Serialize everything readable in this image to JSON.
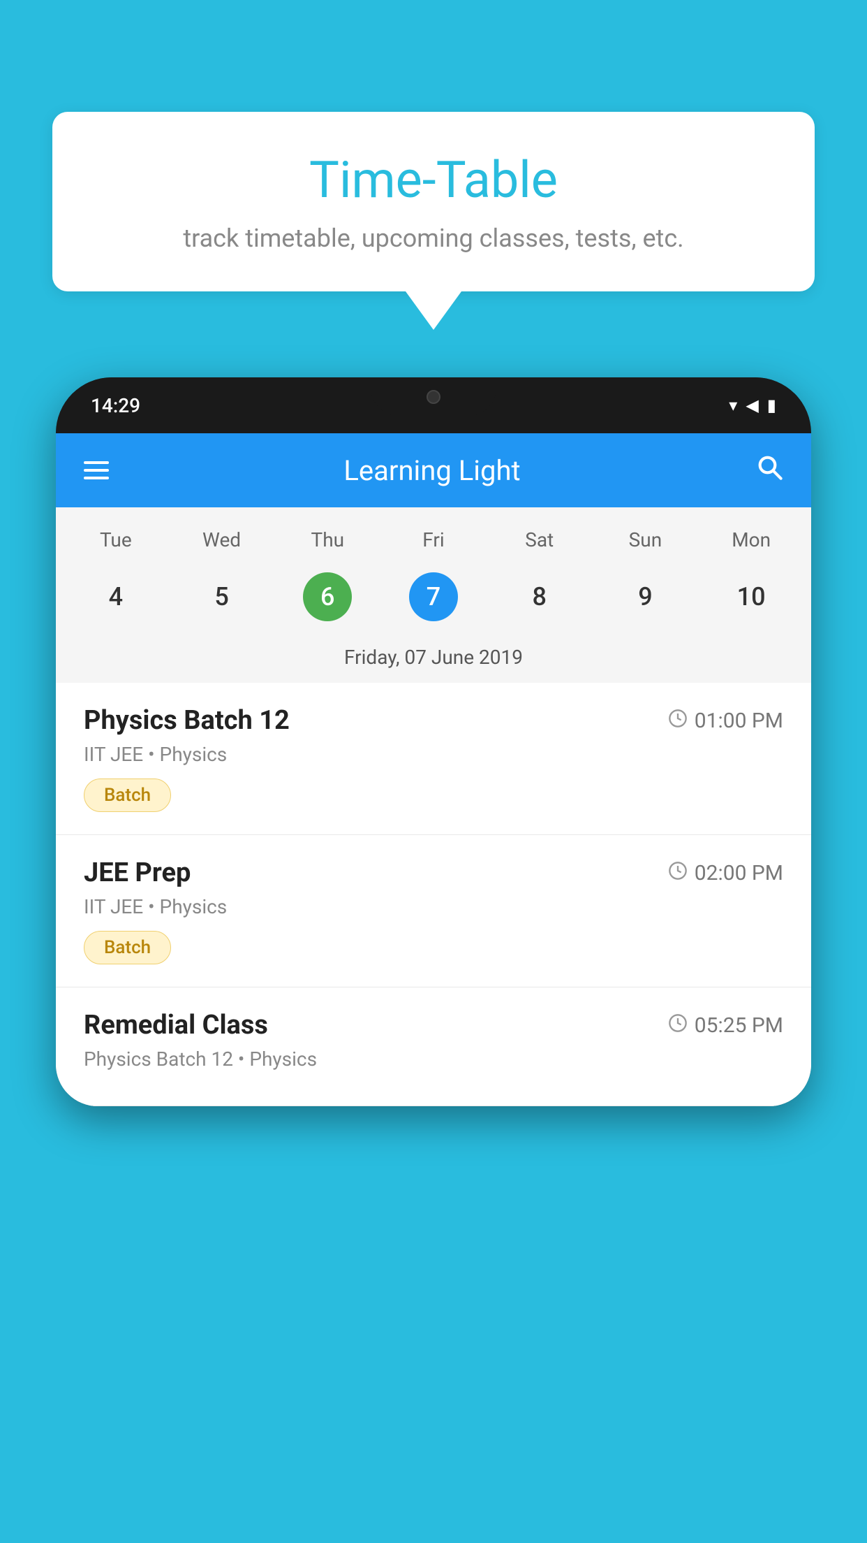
{
  "background_color": "#29BCDE",
  "speech_bubble": {
    "title": "Time-Table",
    "subtitle": "track timetable, upcoming classes, tests, etc."
  },
  "phone": {
    "status_bar": {
      "time": "14:29"
    },
    "app_bar": {
      "title": "Learning Light"
    },
    "calendar": {
      "days": [
        "Tue",
        "Wed",
        "Thu",
        "Fri",
        "Sat",
        "Sun",
        "Mon"
      ],
      "dates": [
        "4",
        "5",
        "6",
        "7",
        "8",
        "9",
        "10"
      ],
      "today_index": 2,
      "selected_index": 3,
      "selected_label": "Friday, 07 June 2019"
    },
    "schedule": [
      {
        "title": "Physics Batch 12",
        "time": "01:00 PM",
        "subtitle": "IIT JEE • Physics",
        "tag": "Batch"
      },
      {
        "title": "JEE Prep",
        "time": "02:00 PM",
        "subtitle": "IIT JEE • Physics",
        "tag": "Batch"
      },
      {
        "title": "Remedial Class",
        "time": "05:25 PM",
        "subtitle": "Physics Batch 12 • Physics",
        "tag": ""
      }
    ]
  }
}
